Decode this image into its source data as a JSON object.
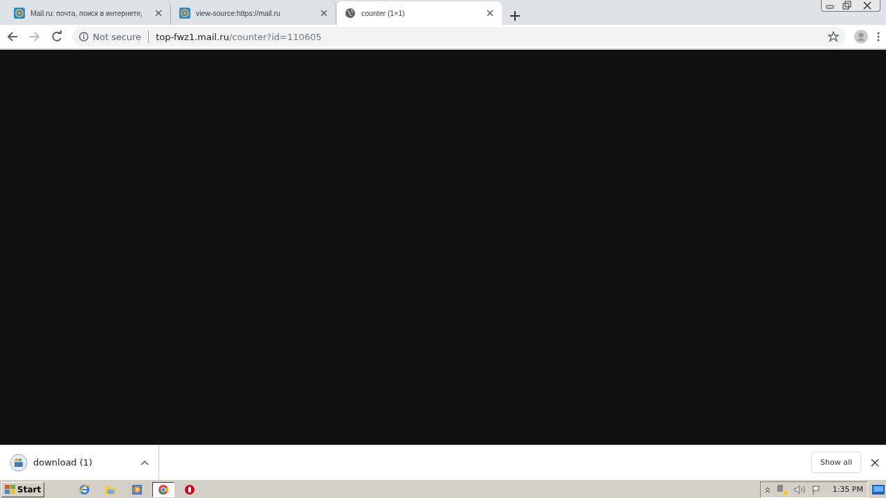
{
  "tabs": [
    {
      "title": "Mail.ru: почта, поиск в интернете,",
      "kind": "mail",
      "selected": false
    },
    {
      "title": "view-source:https://mail.ru",
      "kind": "mail",
      "selected": false
    },
    {
      "title": "counter (1×1)",
      "kind": "globe",
      "selected": true
    }
  ],
  "address_bar": {
    "security": "Not secure",
    "host": "top-fwz1.mail.ru",
    "path": "/counter?id=110605"
  },
  "download_shelf": {
    "items": [
      {
        "name": "download (1)"
      }
    ],
    "show_all": "Show all"
  },
  "taskbar": {
    "start": "Start",
    "apps": [
      {
        "kind": "ie",
        "selected": false
      },
      {
        "kind": "folder",
        "selected": false
      },
      {
        "kind": "media",
        "selected": false
      },
      {
        "kind": "chrome",
        "selected": true
      },
      {
        "kind": "opera",
        "selected": false
      }
    ],
    "clock": "1:35 PM"
  }
}
